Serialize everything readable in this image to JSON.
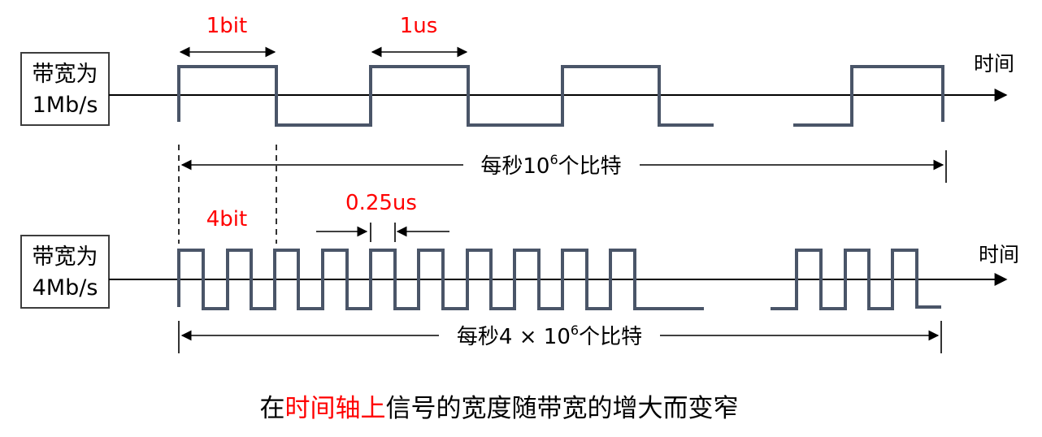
{
  "top": {
    "box_line1": "带宽为",
    "box_line2": "1Mb/s",
    "axis_label": "时间",
    "label_bit": "1bit",
    "label_time": "1us",
    "span_label_prefix": "每秒10",
    "span_label_sup": "6",
    "span_label_suffix": "个比特"
  },
  "bottom": {
    "box_line1": "带宽为",
    "box_line2": "4Mb/s",
    "axis_label": "时间",
    "label_bit": "4bit",
    "label_time": "0.25us",
    "span_label_prefix": "每秒4 × 10",
    "span_label_sup": "6",
    "span_label_suffix": "个比特"
  },
  "caption": {
    "part1": "在",
    "highlight": "时间轴上",
    "part2": "信号的宽度随带宽的增大而变窄"
  },
  "colors": {
    "highlight": "#ff0000",
    "wave": "#4a5568"
  }
}
